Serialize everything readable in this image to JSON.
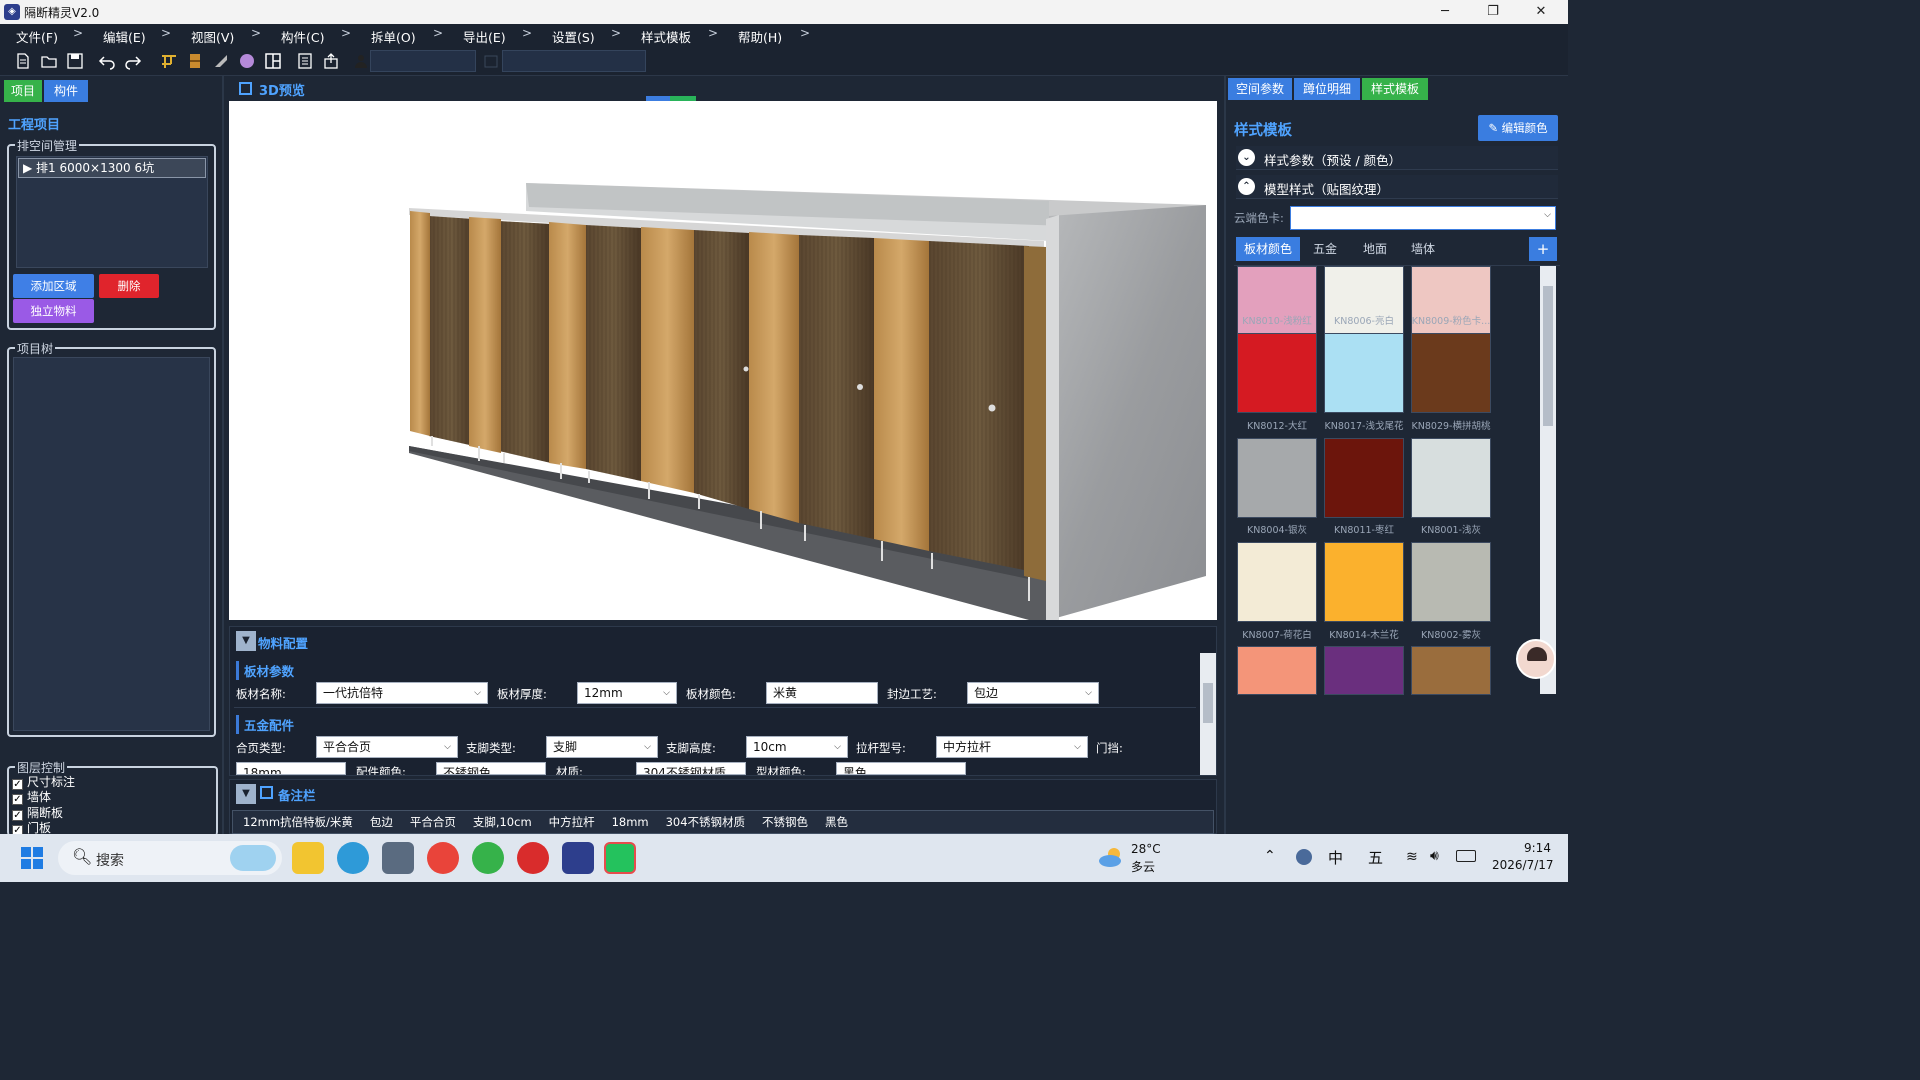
{
  "window": {
    "title": "隔断精灵V2.0",
    "minimize": "─",
    "restore": "❐",
    "close": "✕"
  },
  "menu": [
    "文件(F)",
    "编辑(E)",
    "视图(V)",
    "构件(C)",
    "拆单(O)",
    "导出(E)",
    "设置(S)",
    "样式模板",
    "帮助(H)"
  ],
  "menu_sep": ">",
  "toolbar": {
    "more_label": "···"
  },
  "left": {
    "tabs": [
      "项目",
      "构件"
    ],
    "section": "工程项目",
    "room_group": "排空间管理",
    "room_item": "▶ 排1  6000×1300 6坑",
    "btn_add": "添加区域",
    "btn_delete": "删除",
    "btn_material": "独立物料",
    "tree_group": "项目树",
    "layer_group": "图层控制",
    "layers": [
      "尺寸标注",
      "墙体",
      "隔断板",
      "门板"
    ]
  },
  "viewport": {
    "title": "3D预览"
  },
  "material": {
    "title": "物料配置",
    "board_section": "板材参数",
    "board_name_label": "板材名称:",
    "board_name": "一代抗倍特",
    "thickness_label": "板材厚度:",
    "thickness": "12mm",
    "color_label": "板材颜色:",
    "color": "米黄",
    "edge_label": "封边工艺:",
    "edge": "包边",
    "hw_section": "五金配件",
    "hinge_label": "合页类型:",
    "hinge": "平合合页",
    "foot_label": "支脚类型:",
    "foot": "支脚",
    "foot_h_label": "支脚高度:",
    "foot_h": "10cm",
    "rod_label": "拉杆型号:",
    "rod": "中方拉杆",
    "stop_label": "门挡:",
    "r3_a": "18mm",
    "r3_b_label": "配件颜色:",
    "r3_b": "不锈钢色",
    "r3_c_label": "材质:",
    "r3_c": "304不锈钢材质",
    "r3_d_label": "型材颜色:",
    "r3_d": "黑色"
  },
  "notes": {
    "title": "备注栏",
    "items": [
      "12mm抗倍特板/米黄",
      "包边",
      "平合合页",
      "支脚,10cm",
      "中方拉杆",
      "18mm",
      "304不锈钢材质",
      "不锈钢色",
      "黑色"
    ]
  },
  "right": {
    "tabs": [
      "空间参数",
      "蹲位明细",
      "样式模板"
    ],
    "title": "样式模板",
    "edit_color": "编辑颜色",
    "acc1": "样式参数（预设 / 颜色）",
    "acc2": "模型样式（贴图纹理）",
    "cloud_label": "云端色卡:",
    "color_tabs": [
      "板材颜色",
      "五金",
      "地面",
      "墙体"
    ],
    "add": "+",
    "swatches": [
      {
        "name": "KN8010-浅粉红",
        "color": "#e3a0bd"
      },
      {
        "name": "KN8006-亮白",
        "color": "#f0f0ea"
      },
      {
        "name": "KN8009-粉色卡...",
        "color": "#eec7c2"
      },
      {
        "name": "KN8012-大红",
        "color": "#d51a22"
      },
      {
        "name": "KN8017-浅戈尾花",
        "color": "#abe0f3"
      },
      {
        "name": "KN8029-横拼胡桃",
        "color": "#6b3a1c"
      },
      {
        "name": "KN8004-银灰",
        "color": "#a6a9ab"
      },
      {
        "name": "KN8011-枣红",
        "color": "#6c150c"
      },
      {
        "name": "KN8001-浅灰",
        "color": "#d7dede"
      },
      {
        "name": "KN8007-荷花白",
        "color": "#f3ebd6"
      },
      {
        "name": "KN8014-木兰花",
        "color": "#fbb12d"
      },
      {
        "name": "KN8002-雾灰",
        "color": "#b8bab2"
      },
      {
        "name": "",
        "color": "#f49579"
      },
      {
        "name": "",
        "color": "#6a2f7e"
      },
      {
        "name": "",
        "color": "#9a6d3d"
      }
    ]
  },
  "taskbar": {
    "search": "搜索",
    "temp": "28°C",
    "weather": "多云",
    "ime1": "中",
    "ime2": "五",
    "time": "9:14",
    "date": "2026/7/17"
  }
}
